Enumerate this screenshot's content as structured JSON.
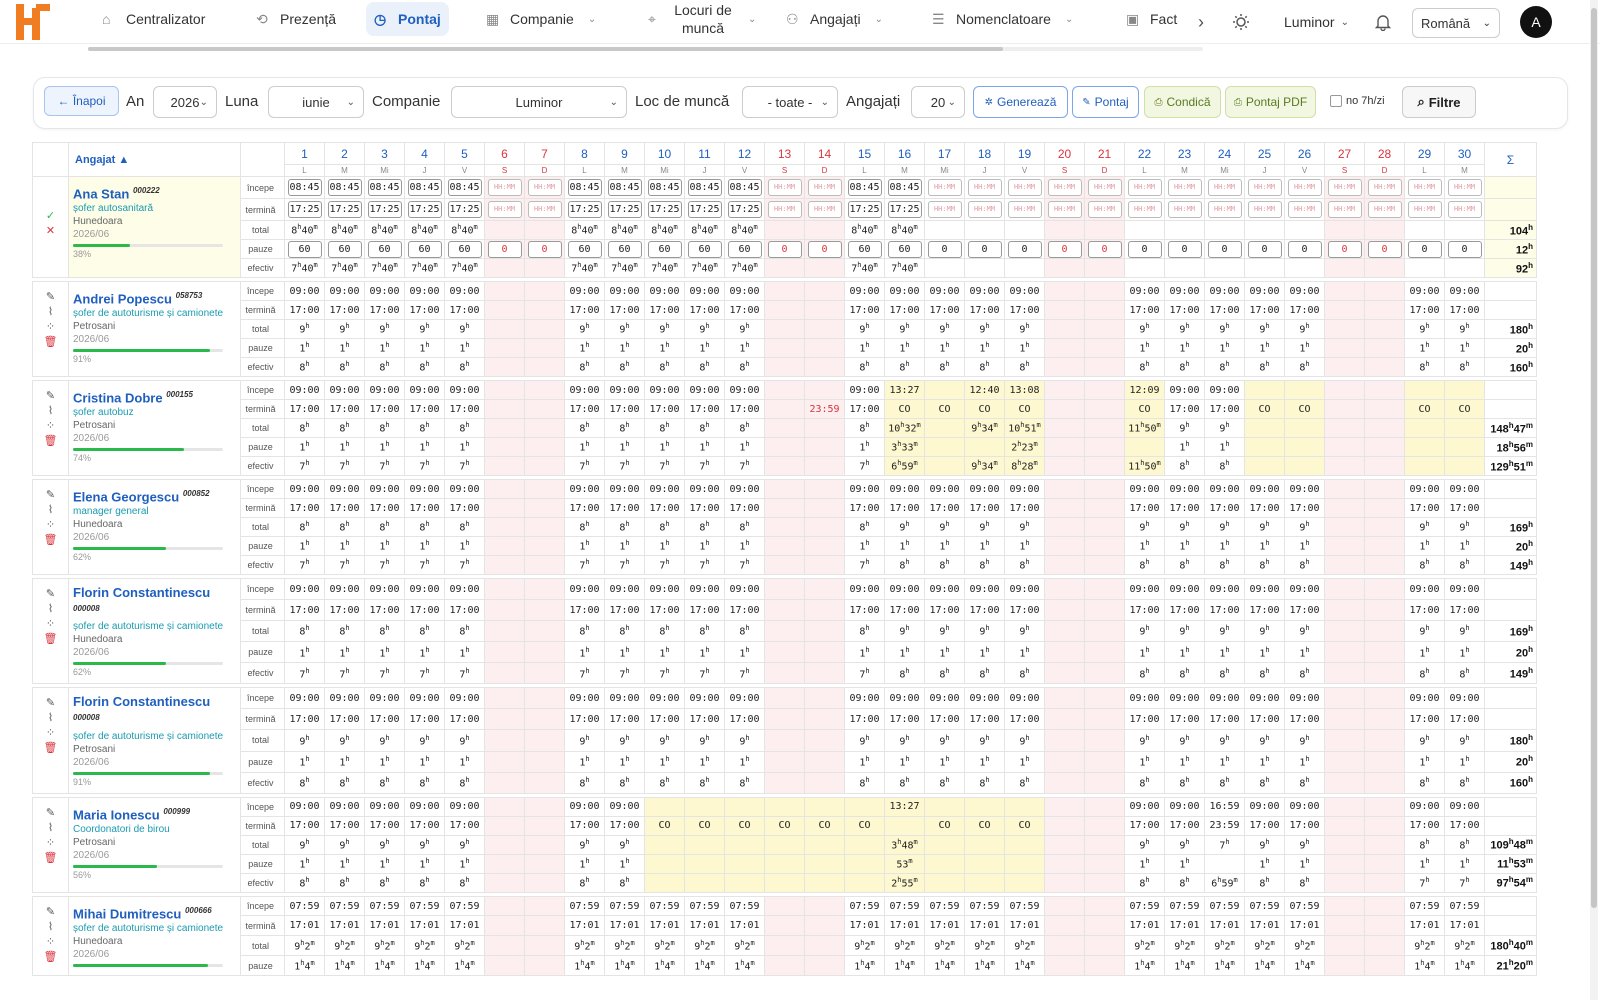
{
  "nav": {
    "items": [
      {
        "label": "Centralizator",
        "icon": "home-icon"
      },
      {
        "label": "Prezență",
        "icon": "fingerprint-icon"
      },
      {
        "label": "Pontaj",
        "icon": "clock-icon",
        "active": true
      },
      {
        "label": "Companie",
        "icon": "building-icon",
        "dropdown": true
      },
      {
        "label": "Locuri de muncă",
        "icon": "pin-icon",
        "dropdown": true
      },
      {
        "label": "Angajați",
        "icon": "users-icon",
        "dropdown": true
      },
      {
        "label": "Nomenclatoare",
        "icon": "list-icon",
        "dropdown": true
      },
      {
        "label": "Fact",
        "icon": "invoice-icon"
      }
    ],
    "company": "Luminor",
    "language": "Română",
    "avatar": "A"
  },
  "filters": {
    "back": "← Înapoi",
    "year_label": "An",
    "year": "2026",
    "month_label": "Luna",
    "month": "iunie",
    "company_label": "Companie",
    "company": "Luminor",
    "workplace_label": "Loc de muncă",
    "workplace": "- toate -",
    "employees_label": "Angajați",
    "employees": "20",
    "generate": "Generează",
    "pontaj": "Pontaj",
    "condica": "Condică",
    "pdf": "Pontaj PDF",
    "no7h": "no 7h/zi",
    "filtre": "Filtre"
  },
  "table": {
    "employee_header": "Angajat ▲",
    "sum_header": "Σ",
    "row_labels": [
      "începe",
      "termină",
      "total",
      "pauze",
      "efectiv"
    ],
    "days": [
      {
        "n": "1",
        "d": "L"
      },
      {
        "n": "2",
        "d": "M"
      },
      {
        "n": "3",
        "d": "Mi"
      },
      {
        "n": "4",
        "d": "J"
      },
      {
        "n": "5",
        "d": "V"
      },
      {
        "n": "6",
        "d": "S",
        "w": 1
      },
      {
        "n": "7",
        "d": "D",
        "w": 1
      },
      {
        "n": "8",
        "d": "L"
      },
      {
        "n": "9",
        "d": "M"
      },
      {
        "n": "10",
        "d": "Mi"
      },
      {
        "n": "11",
        "d": "J"
      },
      {
        "n": "12",
        "d": "V"
      },
      {
        "n": "13",
        "d": "S",
        "w": 1
      },
      {
        "n": "14",
        "d": "D",
        "w": 1
      },
      {
        "n": "15",
        "d": "L"
      },
      {
        "n": "16",
        "d": "M"
      },
      {
        "n": "17",
        "d": "Mi"
      },
      {
        "n": "18",
        "d": "J"
      },
      {
        "n": "19",
        "d": "V"
      },
      {
        "n": "20",
        "d": "S",
        "w": 1
      },
      {
        "n": "21",
        "d": "D",
        "w": 1
      },
      {
        "n": "22",
        "d": "L"
      },
      {
        "n": "23",
        "d": "M"
      },
      {
        "n": "24",
        "d": "Mi"
      },
      {
        "n": "25",
        "d": "J"
      },
      {
        "n": "26",
        "d": "V"
      },
      {
        "n": "27",
        "d": "S",
        "w": 1
      },
      {
        "n": "28",
        "d": "D",
        "w": 1
      },
      {
        "n": "29",
        "d": "L"
      },
      {
        "n": "30",
        "d": "M"
      }
    ]
  },
  "employees": [
    {
      "name": "Ana Stan",
      "code": "000222",
      "role": "șofer autosanitară",
      "city": "Hunedoara",
      "period": "2026/06",
      "pct": "38%",
      "progress": 0.38,
      "editing": true,
      "sums": [
        "",
        "",
        "104h",
        "12h",
        "92h"
      ]
    },
    {
      "name": "Andrei Popescu",
      "code": "058753",
      "role": "șofer de autoturisme și camionete",
      "city": "Petrosani",
      "period": "2026/06",
      "pct": "91%",
      "progress": 0.91,
      "sums": [
        "",
        "",
        "180h",
        "20h",
        "160h"
      ]
    },
    {
      "name": "Cristina Dobre",
      "code": "000155",
      "role": "șofer autobuz",
      "city": "Petrosani",
      "period": "2026/06",
      "pct": "74%",
      "progress": 0.74,
      "sums": [
        "",
        "",
        "148h47m",
        "18h56m",
        "129h51m"
      ]
    },
    {
      "name": "Elena Georgescu",
      "code": "000852",
      "role": "manager general",
      "city": "Hunedoara",
      "period": "2026/06",
      "pct": "62%",
      "progress": 0.62,
      "sums": [
        "",
        "",
        "169h",
        "20h",
        "149h"
      ]
    },
    {
      "name": "Florin Constantinescu",
      "code": "000008",
      "role": "șofer de autoturisme și camionete",
      "city": "Hunedoara",
      "period": "2026/06",
      "pct": "62%",
      "progress": 0.62,
      "sums": [
        "",
        "",
        "169h",
        "20h",
        "149h"
      ]
    },
    {
      "name": "Florin Constantinescu",
      "code": "000008",
      "role": "șofer de autoturisme și camionete",
      "city": "Petrosani",
      "period": "2026/06",
      "pct": "91%",
      "progress": 0.91,
      "sums": [
        "",
        "",
        "180h",
        "20h",
        "160h"
      ]
    },
    {
      "name": "Maria Ionescu",
      "code": "000999",
      "role": "Coordonatori de birou",
      "city": "Petrosani",
      "period": "2026/06",
      "pct": "56%",
      "progress": 0.56,
      "sums": [
        "",
        "",
        "109h48m",
        "11h53m",
        "97h54m"
      ]
    },
    {
      "name": "Mihai Dumitrescu",
      "code": "000666",
      "role": "șofer de autoturisme și camionete",
      "city": "Hunedoara",
      "period": "2026/06",
      "pct": "",
      "progress": 0.9,
      "sums": [
        "",
        "",
        "180h40m",
        "21h20m",
        ""
      ]
    }
  ]
}
